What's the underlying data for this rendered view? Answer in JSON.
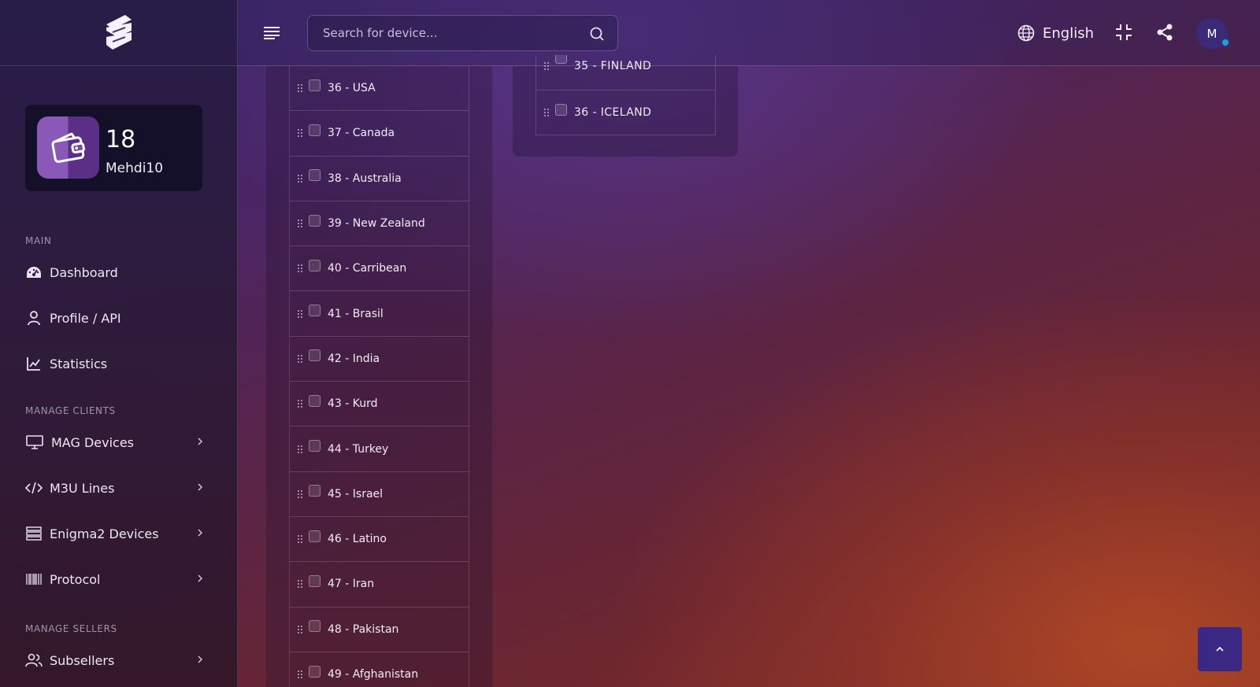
{
  "app": {
    "logo": "brand-logo"
  },
  "header": {
    "search_placeholder": "Search for device...",
    "language": "English",
    "avatar_initial": "M"
  },
  "wallet": {
    "count": "18",
    "username": "Mehdi10"
  },
  "sidebar": {
    "sections": {
      "main": "MAIN",
      "manage_clients": "MANAGE CLIENTS",
      "manage_sellers": "MANAGE SELLERS"
    },
    "items": [
      {
        "label": "Dashboard",
        "icon": "dashboard-icon"
      },
      {
        "label": "Profile / API",
        "icon": "user-icon"
      },
      {
        "label": "Statistics",
        "icon": "chart-icon"
      },
      {
        "label": "MAG Devices",
        "icon": "monitor-icon"
      },
      {
        "label": "M3U Lines",
        "icon": "code-icon"
      },
      {
        "label": "Enigma2 Devices",
        "icon": "server-icon"
      },
      {
        "label": "Protocol",
        "icon": "barcode-icon"
      },
      {
        "label": "Subsellers",
        "icon": "users-icon"
      }
    ]
  },
  "left_list": [
    "36 - USA",
    "37 - Canada",
    "38 - Australia",
    "39 - New Zealand",
    "40 - Carribean",
    "41 - Brasil",
    "42 - India",
    "43 - Kurd",
    "44 - Turkey",
    "45 - Israel",
    "46 - Latino",
    "47 - Iran",
    "48 - Pakistan",
    "49 - Afghanistan"
  ],
  "right_list": [
    "35 - FINLAND",
    "36 - ICELAND"
  ]
}
